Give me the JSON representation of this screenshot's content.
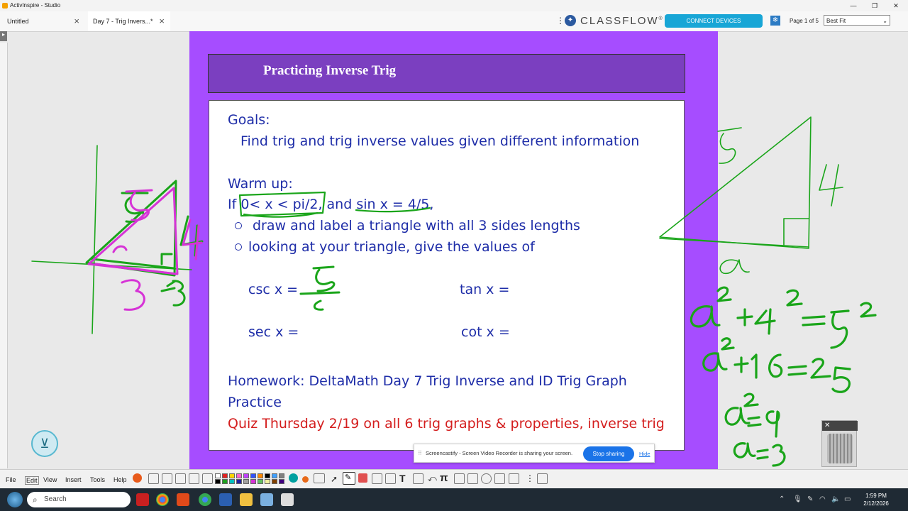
{
  "window": {
    "title": "ActivInspire - Studio"
  },
  "tabs": [
    {
      "label": "Untitled"
    },
    {
      "label": "Day 7 - Trig Invers...*"
    }
  ],
  "classflow": {
    "logo": "CLASSFLOW",
    "logo_mark": "®",
    "connect_label": "CONNECT DEVICES"
  },
  "page_indicator": "Page 1 of 5",
  "zoom": {
    "selected": "Best Fit"
  },
  "slide": {
    "title": "Practicing Inverse Trig",
    "goals_label": "Goals:",
    "goal_text": "Find trig and trig inverse values given different information",
    "warmup_label": "Warm up:",
    "if_line": "If 0< x < pi/2, and sin x = 4/5,",
    "bullet1": "draw and label a triangle with all 3 sides lengths",
    "bullet2": "looking at your triangle, give the values of",
    "csc": "csc x =",
    "tan": "tan x =",
    "sec": "sec x =",
    "cot": "cot x =",
    "homework_1": "Homework: DeltaMath Day 7 Trig Inverse and ID Trig Graph",
    "homework_2": "Practice",
    "quiz": "Quiz Thursday 2/19 on all 6 trig graphs & properties, inverse trig"
  },
  "screencastify": {
    "message": "Screencastify - Screen Video Recorder is sharing your screen.",
    "stop_label": "Stop sharing",
    "hide_label": "Hide"
  },
  "menus": [
    "File",
    "Edit",
    "View",
    "Insert",
    "Tools",
    "Help"
  ],
  "taskbar": {
    "search_placeholder": "Search",
    "time": "1:59 PM",
    "date": "2/12/2026"
  },
  "colors": {
    "slide_bg": "#a64dff",
    "banner": "#7b3fc0",
    "text_blue": "#1e2da8",
    "quiz_red": "#d41e1e",
    "ink_green": "#1aa51a",
    "ink_magenta": "#d633d6"
  },
  "icons": {
    "app": "activinspire-icon",
    "tab_close": "close-icon",
    "more": "kebab-icon",
    "classflow": "classflow-icon",
    "snowflake": "snowflake-icon",
    "zoom_chevron": "chevron-down-icon",
    "expand_toolbox": "expand-icon",
    "trash": "trash-icon",
    "search": "search-icon",
    "start": "windows-start-icon"
  }
}
